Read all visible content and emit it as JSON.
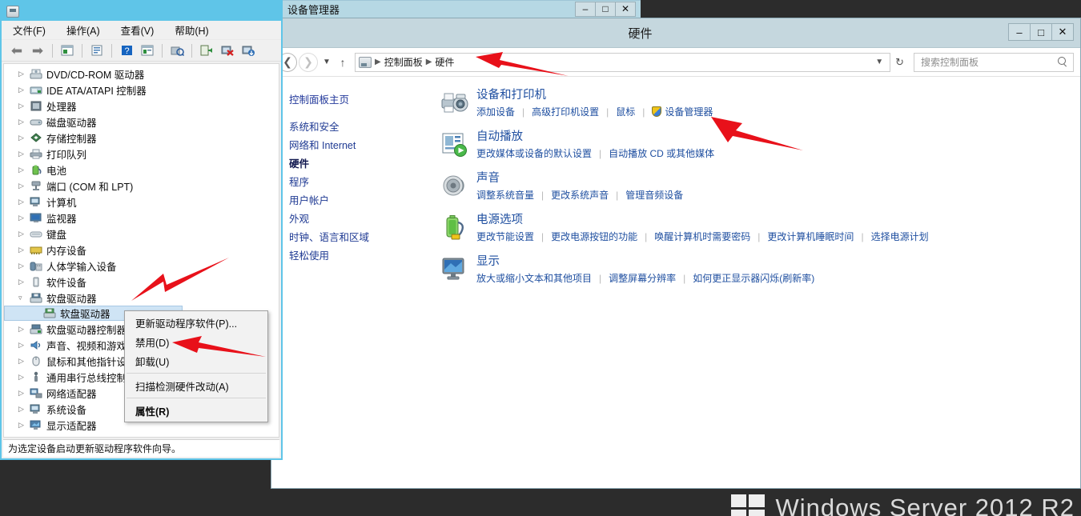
{
  "desktop": {
    "watermark": "Windows Server 2012 R2",
    "logo_icon": "windows-logo-icon",
    "background_color": "#2c2c2c"
  },
  "control_panel": {
    "title": "硬件",
    "window_buttons": {
      "minimize": "–",
      "maximize": "□",
      "close": "✕"
    },
    "nav": {
      "back_icon": "back-arrow-icon",
      "forward_icon": "forward-arrow-icon",
      "recent_icon": "chevron-down-icon",
      "up_icon": "up-arrow-icon",
      "breadcrumb_icon": "control-panel-icon",
      "breadcrumb": [
        "控制面板",
        "硬件"
      ],
      "dropdown_icon": "chevron-down-icon",
      "refresh_icon": "refresh-icon"
    },
    "search": {
      "placeholder": "搜索控制面板",
      "value": "",
      "icon": "search-icon"
    },
    "sidebar": {
      "home": "控制面板主页",
      "items": [
        {
          "label": "系统和安全",
          "current": false
        },
        {
          "label": "网络和 Internet",
          "current": false
        },
        {
          "label": "硬件",
          "current": true
        },
        {
          "label": "程序",
          "current": false
        },
        {
          "label": "用户帐户",
          "current": false
        },
        {
          "label": "外观",
          "current": false
        },
        {
          "label": "时钟、语言和区域",
          "current": false
        },
        {
          "label": "轻松使用",
          "current": false
        }
      ]
    },
    "sections": [
      {
        "icon": "devices-and-printers-icon",
        "title": "设备和打印机",
        "links": [
          {
            "label": "添加设备",
            "shield": false
          },
          {
            "label": "高级打印机设置",
            "shield": false
          },
          {
            "label": "鼠标",
            "shield": false
          },
          {
            "label": "设备管理器",
            "shield": true
          }
        ]
      },
      {
        "icon": "autoplay-icon",
        "title": "自动播放",
        "links": [
          {
            "label": "更改媒体或设备的默认设置",
            "shield": false
          },
          {
            "label": "自动播放 CD 或其他媒体",
            "shield": false
          }
        ]
      },
      {
        "icon": "sound-icon",
        "title": "声音",
        "links": [
          {
            "label": "调整系统音量",
            "shield": false
          },
          {
            "label": "更改系统声音",
            "shield": false
          },
          {
            "label": "管理音频设备",
            "shield": false
          }
        ]
      },
      {
        "icon": "power-options-icon",
        "title": "电源选项",
        "links": [
          {
            "label": "更改节能设置",
            "shield": false
          },
          {
            "label": "更改电源按钮的功能",
            "shield": false
          },
          {
            "label": "唤醒计算机时需要密码",
            "shield": false
          },
          {
            "label": "更改计算机睡眠时间",
            "shield": false
          },
          {
            "label": "选择电源计划",
            "shield": false
          }
        ]
      },
      {
        "icon": "display-icon",
        "title": "显示",
        "links": [
          {
            "label": "放大或缩小文本和其他项目",
            "shield": false
          },
          {
            "label": "调整屏幕分辨率",
            "shield": false
          },
          {
            "label": "如何更正显示器闪烁(刷新率)",
            "shield": false
          }
        ]
      }
    ]
  },
  "device_manager": {
    "title": "设备管理器",
    "title_icon": "device-manager-icon",
    "window_buttons": {
      "minimize": "–",
      "maximize": "□",
      "close": "✕"
    },
    "menus": [
      "文件(F)",
      "操作(A)",
      "查看(V)",
      "帮助(H)"
    ],
    "toolbar": [
      "back-arrow-icon",
      "forward-arrow-icon",
      "show-hide-console-tree-icon",
      "properties-icon",
      "help-icon",
      "list-view-icon",
      "update-driver-icon",
      "uninstall-device-icon",
      "disable-device-icon",
      "scan-hardware-icon"
    ],
    "tree": [
      {
        "label": "DVD/CD-ROM 驱动器",
        "icon": "dvd-drive-icon",
        "expander": "collapsed",
        "level": 0,
        "selected": false
      },
      {
        "label": "IDE ATA/ATAPI 控制器",
        "icon": "ide-controller-icon",
        "expander": "collapsed",
        "level": 0,
        "selected": false
      },
      {
        "label": "处理器",
        "icon": "processor-icon",
        "expander": "collapsed",
        "level": 0,
        "selected": false
      },
      {
        "label": "磁盘驱动器",
        "icon": "disk-drive-icon",
        "expander": "collapsed",
        "level": 0,
        "selected": false
      },
      {
        "label": "存储控制器",
        "icon": "storage-controller-icon",
        "expander": "collapsed",
        "level": 0,
        "selected": false
      },
      {
        "label": "打印队列",
        "icon": "print-queue-icon",
        "expander": "collapsed",
        "level": 0,
        "selected": false
      },
      {
        "label": "电池",
        "icon": "battery-icon",
        "expander": "collapsed",
        "level": 0,
        "selected": false
      },
      {
        "label": "端口 (COM 和 LPT)",
        "icon": "ports-icon",
        "expander": "collapsed",
        "level": 0,
        "selected": false
      },
      {
        "label": "计算机",
        "icon": "computer-icon",
        "expander": "collapsed",
        "level": 0,
        "selected": false
      },
      {
        "label": "监视器",
        "icon": "monitor-icon",
        "expander": "collapsed",
        "level": 0,
        "selected": false
      },
      {
        "label": "键盘",
        "icon": "keyboard-icon",
        "expander": "collapsed",
        "level": 0,
        "selected": false
      },
      {
        "label": "内存设备",
        "icon": "memory-device-icon",
        "expander": "collapsed",
        "level": 0,
        "selected": false
      },
      {
        "label": "人体学输入设备",
        "icon": "hid-icon",
        "expander": "collapsed",
        "level": 0,
        "selected": false
      },
      {
        "label": "软件设备",
        "icon": "software-device-icon",
        "expander": "collapsed",
        "level": 0,
        "selected": false
      },
      {
        "label": "软盘驱动器",
        "icon": "floppy-drive-icon",
        "expander": "expanded",
        "level": 0,
        "selected": false
      },
      {
        "label": "软盘驱动器",
        "icon": "floppy-drive-icon",
        "expander": "none",
        "level": 1,
        "selected": true
      },
      {
        "label": "软盘驱动器控制器",
        "icon": "floppy-controller-icon",
        "expander": "collapsed",
        "level": 0,
        "selected": false
      },
      {
        "label": "声音、视频和游戏控制器",
        "icon": "sound-video-icon",
        "expander": "collapsed",
        "level": 0,
        "selected": false
      },
      {
        "label": "鼠标和其他指针设备",
        "icon": "mouse-icon",
        "expander": "collapsed",
        "level": 0,
        "selected": false
      },
      {
        "label": "通用串行总线控制器",
        "icon": "usb-controller-icon",
        "expander": "collapsed",
        "level": 0,
        "selected": false
      },
      {
        "label": "网络适配器",
        "icon": "network-adapter-icon",
        "expander": "collapsed",
        "level": 0,
        "selected": false
      },
      {
        "label": "系统设备",
        "icon": "system-device-icon",
        "expander": "collapsed",
        "level": 0,
        "selected": false
      },
      {
        "label": "显示适配器",
        "icon": "display-adapter-icon",
        "expander": "collapsed",
        "level": 0,
        "selected": false
      }
    ],
    "status": "为选定设备启动更新驱动程序软件向导。"
  },
  "context_menu": {
    "items": [
      {
        "label": "更新驱动程序软件(P)...",
        "bold": false,
        "separator_after": false
      },
      {
        "label": "禁用(D)",
        "bold": false,
        "separator_after": false
      },
      {
        "label": "卸载(U)",
        "bold": false,
        "separator_after": true
      },
      {
        "label": "扫描检测硬件改动(A)",
        "bold": false,
        "separator_after": true
      },
      {
        "label": "属性(R)",
        "bold": true,
        "separator_after": false
      }
    ]
  },
  "annotations": {
    "color": "#e8111a",
    "arrows": [
      {
        "name": "arrow-pointing-breadcrumb-hardware"
      },
      {
        "name": "arrow-pointing-device-manager-link"
      },
      {
        "name": "arrow-pointing-floppy-drive-node"
      },
      {
        "name": "arrow-pointing-disable-menu-item"
      }
    ]
  }
}
